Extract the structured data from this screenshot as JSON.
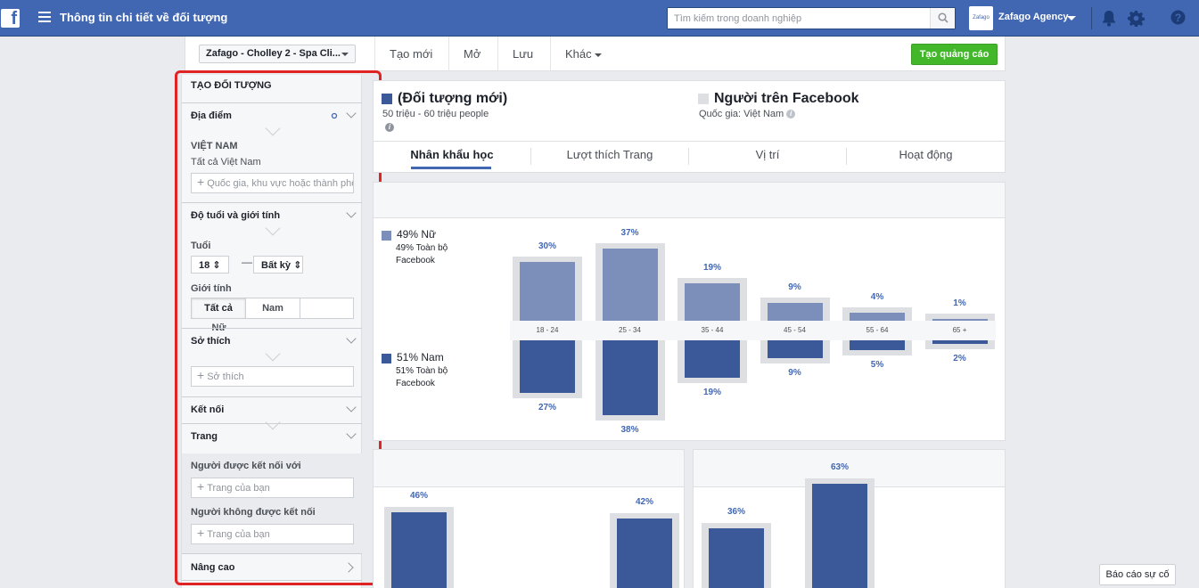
{
  "topbar": {
    "logo_letter": "f",
    "title": "Thông tin chi tiết về đối tượng",
    "search_placeholder": "Tìm kiếm trong doanh nghiệp",
    "agency_logo_text": "Zafago",
    "agency_name": "Zafago Agency",
    "icons": [
      "hamburger-icon",
      "search-icon",
      "bell-icon",
      "gear-icon",
      "help-icon"
    ]
  },
  "toolbar": {
    "account": "Zafago - Cholley 2 - Spa Cli...",
    "items": [
      "Tạo mới",
      "Mở",
      "Lưu",
      "Khác"
    ],
    "create_ad": "Tạo quảng cáo"
  },
  "sidebar": {
    "title": "TẠO ĐỐI TƯỢNG",
    "location": {
      "header": "Địa điểm",
      "country": "VIỆT NAM",
      "scope": "Tất cả Việt Nam",
      "placeholder": "Quốc gia, khu vực hoặc thành phố"
    },
    "age_gender": {
      "header": "Độ tuổi và giới tính",
      "age_label": "Tuổi",
      "age_min": "18",
      "age_max": "Bất kỳ",
      "gender_label": "Giới tính",
      "genders": [
        "Tất cả",
        "Nam",
        "Nữ"
      ],
      "selected_gender": "Tất cả"
    },
    "interests": {
      "header": "Sở thích",
      "placeholder": "Sở thích"
    },
    "connections": {
      "header": "Kết nối",
      "pages_header": "Trang",
      "connected_label": "Người được kết nối với",
      "connected_placeholder": "Trang của bạn",
      "not_connected_label": "Người không được kết nối",
      "not_connected_placeholder": "Trang của bạn"
    },
    "advanced": "Nâng cao",
    "highlight_color": "#e02424"
  },
  "audience": {
    "new": {
      "title": "(Đối tượng mới)",
      "size": "50 triệu - 60 triệu people",
      "color": "#3b5998"
    },
    "facebook": {
      "title": "Người trên Facebook",
      "country": "Quốc gia: Việt Nam",
      "color": "#dddfe2"
    }
  },
  "tabs": [
    "Nhân khẩu học",
    "Lượt thích Trang",
    "Vị trí",
    "Hoạt động"
  ],
  "active_tab": "Nhân khẩu học",
  "demographics": {
    "female": {
      "title": "49% Nữ",
      "sub": "49% Toàn bộ Facebook",
      "color": "#7b8fba"
    },
    "male": {
      "title": "51% Nam",
      "sub": "51% Toàn bộ Facebook",
      "color": "#3b5998"
    }
  },
  "chart_data": [
    {
      "type": "bar",
      "categories": [
        "18 - 24",
        "25 - 34",
        "35 - 44",
        "45 - 54",
        "55 - 64",
        "65 +"
      ],
      "series": [
        {
          "name": "Nữ",
          "values": [
            30,
            37,
            19,
            9,
            4,
            1
          ],
          "labels": [
            "30%",
            "37%",
            "19%",
            "9%",
            "4%",
            "1%"
          ]
        },
        {
          "name": "Nam",
          "values": [
            27,
            38,
            19,
            9,
            5,
            2
          ],
          "labels": [
            "27%",
            "38%",
            "19%",
            "9%",
            "5%",
            "2%"
          ]
        }
      ]
    },
    {
      "type": "bar",
      "values": [
        46,
        42
      ],
      "labels": [
        "46%",
        "42%"
      ]
    },
    {
      "type": "bar",
      "values": [
        36,
        63
      ],
      "labels": [
        "36%",
        "63%"
      ]
    }
  ],
  "report_button": "Báo cáo sự cố"
}
